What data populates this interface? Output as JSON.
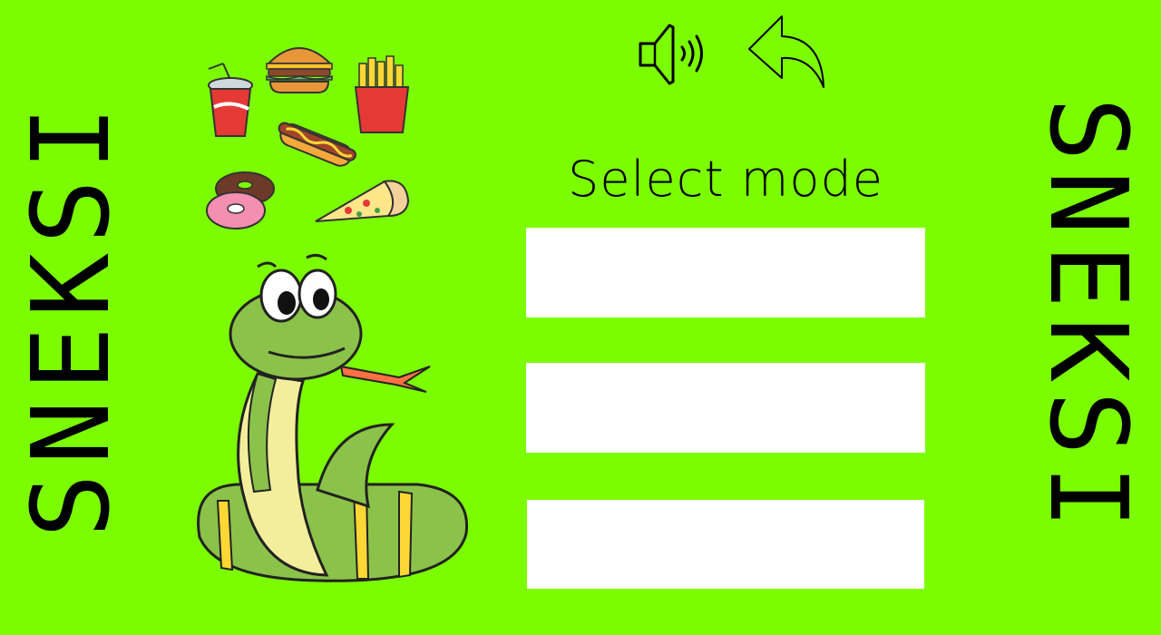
{
  "game": {
    "title_left": "SNEKSI",
    "title_right": "SNEKSI",
    "heading": "Select mode",
    "modes": [
      {
        "label": ""
      },
      {
        "label": ""
      },
      {
        "label": ""
      }
    ]
  },
  "icons": {
    "sound": "speaker-icon",
    "back": "back-arrow-icon",
    "foods": [
      "soda-cup",
      "burger",
      "fries",
      "hot-dog",
      "donuts",
      "pizza-slice"
    ],
    "mascot": "snake"
  },
  "colors": {
    "background": "#7cfc00",
    "button": "#ffffff",
    "text": "#000000"
  }
}
